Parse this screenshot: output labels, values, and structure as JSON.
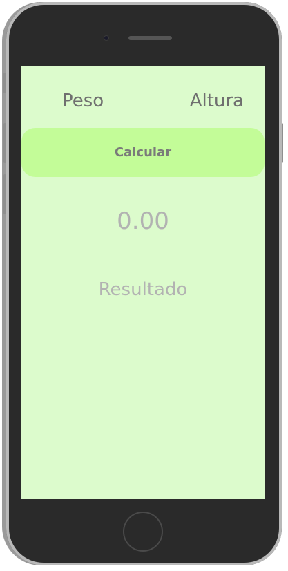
{
  "inputs": {
    "peso_placeholder": "Peso",
    "altura_placeholder": "Altura"
  },
  "actions": {
    "calculate_label": "Calcular"
  },
  "result": {
    "value": "0.00",
    "label": "Resultado"
  },
  "colors": {
    "screen_background": "#dcfbcc",
    "button_background": "#c3fc98",
    "phone_body": "#2a2a2a"
  }
}
